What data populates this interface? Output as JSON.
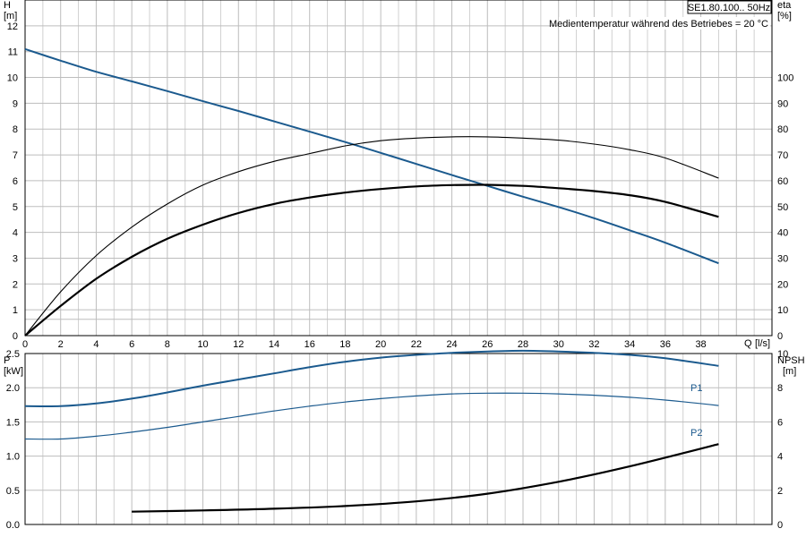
{
  "chart_data": [
    {
      "type": "line",
      "title": "SE1.80.100.. 50Hz",
      "annotation": "Medientemperatur während des Betriebes = 20 °C",
      "xlabel": "Q [l/s]",
      "xlabel_parts": [
        "Q",
        "[l/s]"
      ],
      "ylabel_left": [
        "H",
        "[m]"
      ],
      "ylabel_right": [
        "eta",
        "[%]"
      ],
      "xlim": [
        0,
        42
      ],
      "ylim_left": [
        0,
        13
      ],
      "ylim_right": [
        0,
        130
      ],
      "x_ticks": [
        0,
        2,
        4,
        6,
        8,
        10,
        12,
        14,
        16,
        18,
        20,
        22,
        24,
        26,
        28,
        30,
        32,
        34,
        36,
        38
      ],
      "y_ticks_left": [
        0,
        1,
        2,
        3,
        4,
        5,
        6,
        7,
        8,
        9,
        10,
        11,
        12
      ],
      "y_ticks_right": [
        0,
        10,
        20,
        30,
        40,
        50,
        60,
        70,
        80,
        90,
        100
      ],
      "grid": true,
      "colors": {
        "head": "#1b5a8e",
        "eta": "#000000"
      },
      "series": [
        {
          "axis": "left",
          "x": [
            0,
            2,
            4,
            6,
            8,
            10,
            12,
            14,
            16,
            18,
            20,
            22,
            24,
            26,
            28,
            30,
            32,
            34,
            36,
            39
          ],
          "values": [
            11.1,
            10.65,
            10.22,
            9.85,
            9.47,
            9.08,
            8.7,
            8.3,
            7.9,
            7.5,
            7.08,
            6.65,
            6.22,
            5.8,
            5.38,
            4.98,
            4.55,
            4.08,
            3.6,
            2.8
          ]
        },
        {
          "axis": "right",
          "x": [
            0,
            2,
            4,
            6,
            8,
            10,
            12,
            14,
            16,
            18,
            20,
            22,
            24,
            26,
            28,
            30,
            32,
            34,
            36,
            39
          ],
          "values": [
            0,
            17,
            31,
            42,
            51,
            58.3,
            63.5,
            67.5,
            70.5,
            73.5,
            75.5,
            76.5,
            77,
            77,
            76.5,
            75.7,
            74.2,
            72,
            68.8,
            61
          ]
        },
        {
          "axis": "right",
          "x": [
            0,
            2,
            4,
            6,
            8,
            10,
            12,
            14,
            16,
            18,
            20,
            22,
            24,
            26,
            28,
            30,
            32,
            34,
            36,
            39
          ],
          "values": [
            0,
            11.5,
            22,
            30.5,
            37.5,
            43,
            47.5,
            51,
            53.5,
            55.4,
            56.8,
            57.8,
            58.3,
            58.4,
            58,
            57.1,
            56,
            54.4,
            51.8,
            46
          ]
        }
      ]
    },
    {
      "type": "line",
      "xlim": [
        0,
        42
      ],
      "ylim_left": [
        0,
        2.5
      ],
      "ylim_right": [
        0,
        10
      ],
      "ylabel_left": [
        "P",
        "[kW]"
      ],
      "ylabel_right": [
        "NPSH",
        "[m]"
      ],
      "y_ticks_left": [
        "0.0",
        "0.5",
        "1.0",
        "1.5",
        "2.0",
        "2.5"
      ],
      "y_ticks_left_values": [
        0,
        0.5,
        1.0,
        1.5,
        2.0,
        2.5
      ],
      "y_ticks_right": [
        0,
        2,
        4,
        6,
        8,
        10
      ],
      "grid": true,
      "colors": {
        "p1": "#1b5a8e",
        "p2": "#1b5a8e",
        "npsh": "#000000"
      },
      "series": [
        {
          "name": "P1",
          "axis": "left",
          "x": [
            0,
            2,
            4,
            6,
            8,
            10,
            12,
            14,
            16,
            18,
            20,
            22,
            24,
            26,
            28,
            30,
            32,
            34,
            36,
            39
          ],
          "values": [
            1.73,
            1.73,
            1.77,
            1.84,
            1.93,
            2.03,
            2.12,
            2.21,
            2.3,
            2.38,
            2.44,
            2.48,
            2.51,
            2.53,
            2.54,
            2.53,
            2.51,
            2.48,
            2.43,
            2.32
          ]
        },
        {
          "name": "P2",
          "axis": "left",
          "x": [
            0,
            2,
            4,
            6,
            8,
            10,
            12,
            14,
            16,
            18,
            20,
            22,
            24,
            26,
            28,
            30,
            32,
            34,
            36,
            39
          ],
          "values": [
            1.25,
            1.25,
            1.29,
            1.35,
            1.42,
            1.5,
            1.58,
            1.66,
            1.73,
            1.79,
            1.84,
            1.88,
            1.91,
            1.92,
            1.92,
            1.91,
            1.89,
            1.86,
            1.82,
            1.74
          ]
        },
        {
          "axis": "right",
          "x": [
            6,
            10,
            14,
            18,
            22,
            26,
            30,
            34,
            39
          ],
          "values": [
            0.75,
            0.82,
            0.92,
            1.08,
            1.35,
            1.8,
            2.5,
            3.4,
            4.7
          ]
        }
      ]
    }
  ]
}
